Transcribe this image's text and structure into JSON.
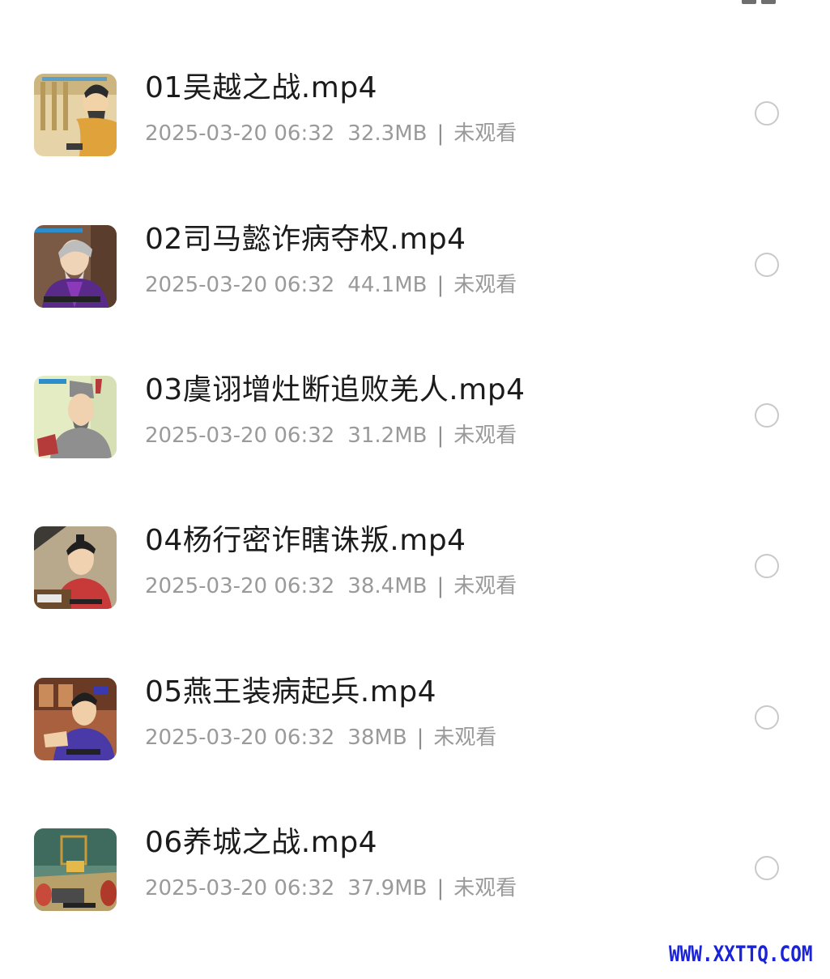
{
  "header": {
    "corner_icon": "grid-view-icon"
  },
  "files": [
    {
      "name": "01吴越之战.mp4",
      "date": "2025-03-20 06:32",
      "size": "32.3MB",
      "status": "未观看",
      "thumb_icon": "video-thumbnail"
    },
    {
      "name": "02司马懿诈病夺权.mp4",
      "date": "2025-03-20 06:32",
      "size": "44.1MB",
      "status": "未观看",
      "thumb_icon": "video-thumbnail"
    },
    {
      "name": "03虞诩增灶断追败羌人.mp4",
      "date": "2025-03-20 06:32",
      "size": "31.2MB",
      "status": "未观看",
      "thumb_icon": "video-thumbnail"
    },
    {
      "name": "04杨行密诈瞎诛叛.mp4",
      "date": "2025-03-20 06:32",
      "size": "38.4MB",
      "status": "未观看",
      "thumb_icon": "video-thumbnail"
    },
    {
      "name": "05燕王装病起兵.mp4",
      "date": "2025-03-20 06:32",
      "size": "38MB",
      "status": "未观看",
      "thumb_icon": "video-thumbnail"
    },
    {
      "name": "06养城之战.mp4",
      "date": "2025-03-20 06:32",
      "size": "37.9MB",
      "status": "未观看",
      "thumb_icon": "video-thumbnail"
    }
  ],
  "separator": "|",
  "watermark": "WWW.XXTTQ.COM",
  "colors": {
    "title": "#1b1b1b",
    "meta": "#9a9a9a",
    "radio_border": "#c9c9c9",
    "watermark": "#1a23d6"
  }
}
